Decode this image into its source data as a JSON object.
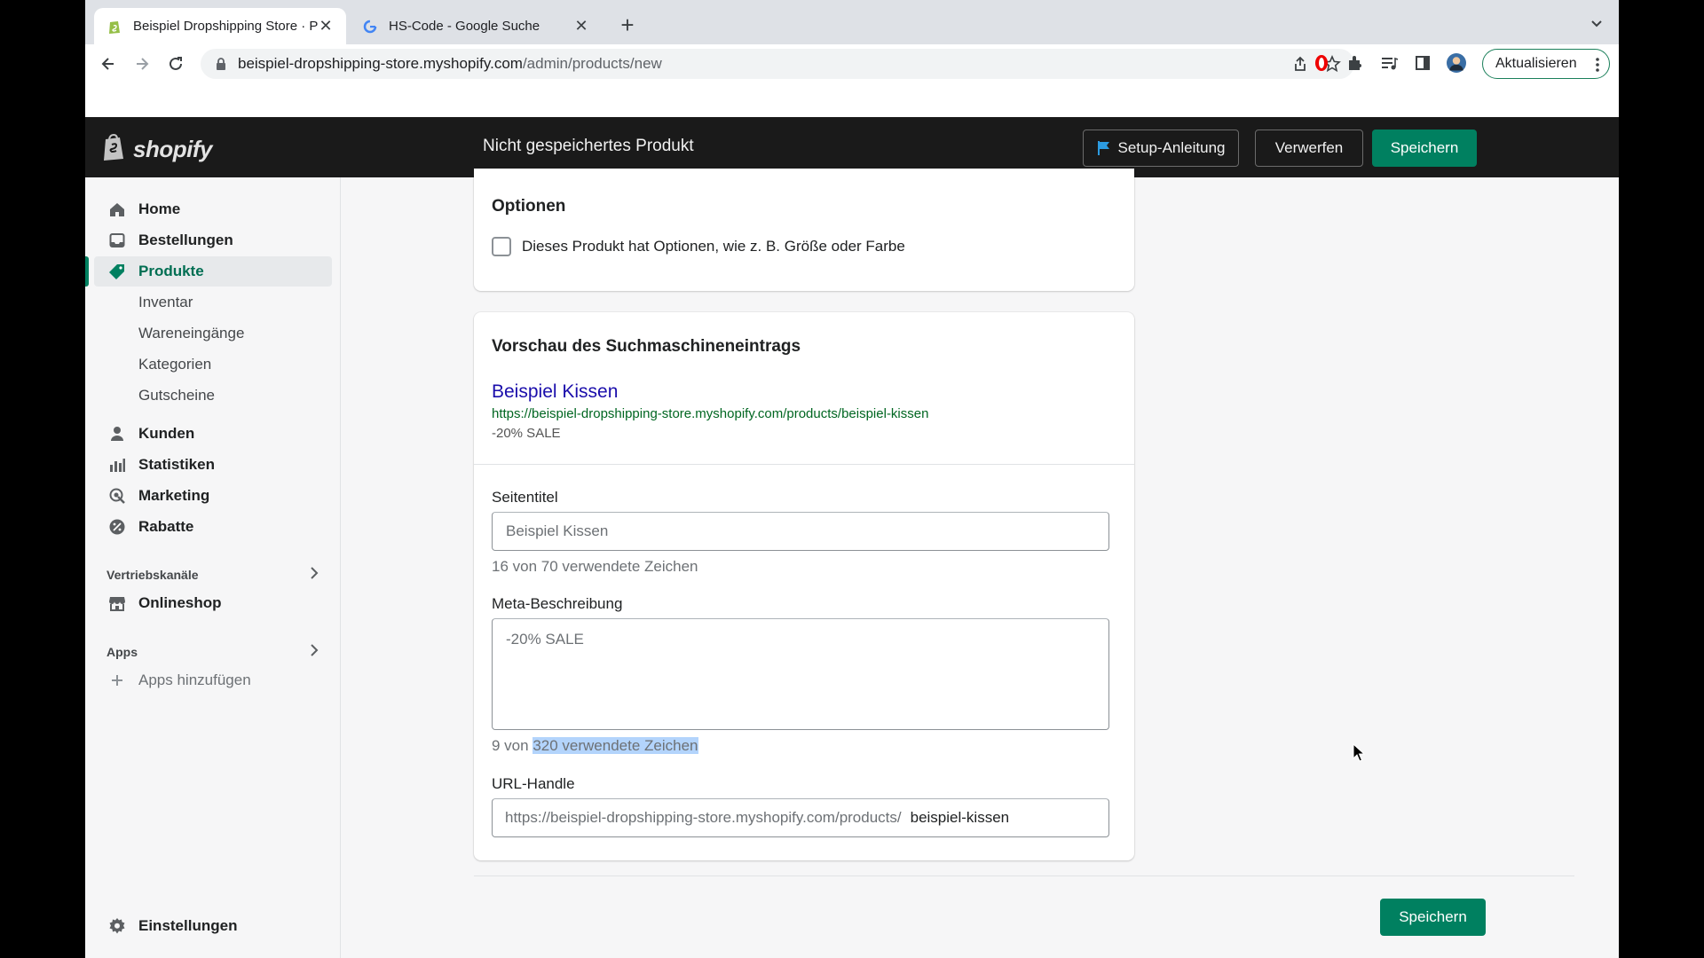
{
  "browser": {
    "tabs": [
      {
        "label": "Beispiel Dropshipping Store · P",
        "favicon": "shopify-favicon-icon",
        "active": true
      },
      {
        "label": "HS-Code - Google Suche",
        "favicon": "google-favicon-icon",
        "active": false
      }
    ],
    "url_domain": "beispiel-dropshipping-store.myshopify.com",
    "url_path": "/admin/products/new",
    "update_label": "Aktualisieren"
  },
  "topbar": {
    "logo_text": "shopify",
    "page_title": "Nicht gespeichertes Produkt",
    "setup_label": "Setup-Anleitung",
    "discard_label": "Verwerfen",
    "save_label": "Speichern"
  },
  "sidebar": {
    "items": [
      {
        "label": "Home",
        "icon": "home-icon"
      },
      {
        "label": "Bestellungen",
        "icon": "orders-icon"
      },
      {
        "label": "Produkte",
        "icon": "tag-icon"
      },
      {
        "label": "Inventar"
      },
      {
        "label": "Wareneingänge"
      },
      {
        "label": "Kategorien"
      },
      {
        "label": "Gutscheine"
      },
      {
        "label": "Kunden",
        "icon": "person-icon"
      },
      {
        "label": "Statistiken",
        "icon": "bar-chart-icon"
      },
      {
        "label": "Marketing",
        "icon": "target-icon"
      },
      {
        "label": "Rabatte",
        "icon": "discount-icon"
      }
    ],
    "sales_channels_heading": "Vertriebskanäle",
    "onlineshop_label": "Onlineshop",
    "apps_heading": "Apps",
    "add_apps_label": "Apps hinzufügen",
    "settings_label": "Einstellungen"
  },
  "options_card": {
    "title": "Optionen",
    "checkbox_label": "Dieses Produkt hat Optionen, wie z. B. Größe oder Farbe"
  },
  "seo_card": {
    "title": "Vorschau des Suchmaschineneintrags",
    "preview_title": "Beispiel Kissen",
    "preview_url": "https://beispiel-dropshipping-store.myshopify.com/products/beispiel-kissen",
    "preview_description": "-20% SALE",
    "page_title_label": "Seitentitel",
    "page_title_value": "Beispiel Kissen",
    "page_title_help": "16 von 70 verwendete Zeichen",
    "meta_label": "Meta-Beschreibung",
    "meta_value": "-20% SALE",
    "meta_help_prefix": "9 von ",
    "meta_help_highlight": "320 verwendete Zeichen",
    "url_handle_label": "URL-Handle",
    "url_handle_prefix": "https://beispiel-dropshipping-store.myshopify.com/products/",
    "url_handle_value": "beispiel-kissen"
  },
  "footer": {
    "save_label": "Speichern"
  },
  "colors": {
    "shopify_green": "#008060",
    "topbar": "#1a1a1a",
    "link_blue": "#1a0dab",
    "url_green": "#006621"
  }
}
